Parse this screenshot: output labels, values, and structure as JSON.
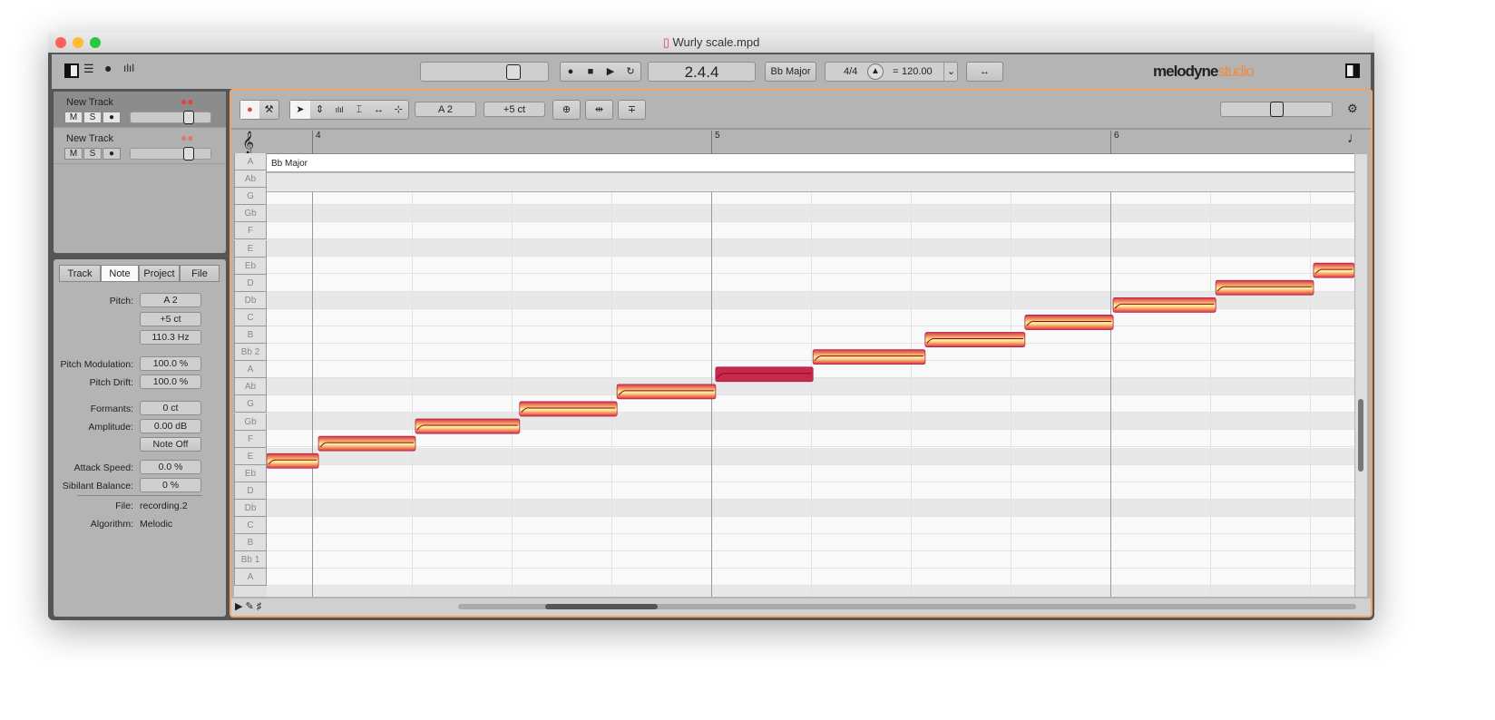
{
  "window": {
    "title": "Wurly scale.mpd"
  },
  "toolbar": {
    "position": "2.4.4",
    "key": "Bb Major",
    "time_signature": "4/4",
    "tempo_eq": "=",
    "tempo": "120.00",
    "brand": "melodyne",
    "brand_edition": "studio",
    "accent": "#f2a468"
  },
  "tracks": [
    {
      "name": "New Track",
      "mute": "M",
      "solo": "S",
      "rec": "●",
      "selected": true
    },
    {
      "name": "New Track",
      "mute": "M",
      "solo": "S",
      "rec": "●",
      "selected": false
    }
  ],
  "inspector": {
    "tabs": [
      "Track",
      "Note",
      "Project",
      "File"
    ],
    "active_tab": "Note",
    "pitch_label": "Pitch:",
    "pitch": "A 2",
    "cents": "+5 ct",
    "freq": "110.3 Hz",
    "fields": [
      {
        "label": "Pitch Modulation:",
        "value": "100.0 %"
      },
      {
        "label": "Pitch Drift:",
        "value": "100.0 %"
      },
      {
        "label": "Formants:",
        "value": "0 ct"
      },
      {
        "label": "Amplitude:",
        "value": "0.00 dB"
      },
      {
        "label": "",
        "value": "Note Off"
      },
      {
        "label": "Attack Speed:",
        "value": "0.0 %"
      },
      {
        "label": "Sibilant Balance:",
        "value": "0 %"
      }
    ],
    "file_label": "File:",
    "file": "recording.2",
    "algorithm_label": "Algorithm:",
    "algorithm": "Melodic"
  },
  "editor": {
    "pitch_field": "A 2",
    "cents_field": "+5 ct",
    "key_lane": "Bb Major",
    "bars": [
      "4",
      "5",
      "6"
    ],
    "pitch_rows": [
      "A",
      "Ab",
      "G",
      "Gb",
      "F",
      "E",
      "Eb",
      "D",
      "Db",
      "C",
      "B",
      "Bb 2",
      "A",
      "Ab",
      "G",
      "Gb",
      "F",
      "E",
      "Eb",
      "D",
      "Db",
      "C",
      "B",
      "Bb 1",
      "A"
    ],
    "shaded_rows": [
      "Gb",
      "Eb",
      "Bb 2",
      "Ab",
      "Bb 1"
    ],
    "notes": [
      {
        "pitch": "E",
        "start": 3.886,
        "end": 4.016
      },
      {
        "pitch": "F",
        "start": 4.016,
        "end": 4.259
      },
      {
        "pitch": "Gb",
        "start": 4.259,
        "end": 4.52
      },
      {
        "pitch": "G",
        "start": 4.52,
        "end": 4.764
      },
      {
        "pitch": "Ab",
        "start": 4.764,
        "end": 5.011
      },
      {
        "pitch": "A",
        "start": 5.011,
        "end": 5.255,
        "selected": true
      },
      {
        "pitch": "Bb",
        "start": 5.255,
        "end": 5.536
      },
      {
        "pitch": "B",
        "start": 5.536,
        "end": 5.786
      },
      {
        "pitch": "C",
        "start": 5.786,
        "end": 6.007
      },
      {
        "pitch": "Db",
        "start": 6.007,
        "end": 6.264
      },
      {
        "pitch": "D",
        "start": 6.264,
        "end": 6.509
      },
      {
        "pitch": "Eb",
        "start": 6.509,
        "end": 6.611
      }
    ],
    "note_color": "#d8304a",
    "note_core": "#fff2a8"
  }
}
